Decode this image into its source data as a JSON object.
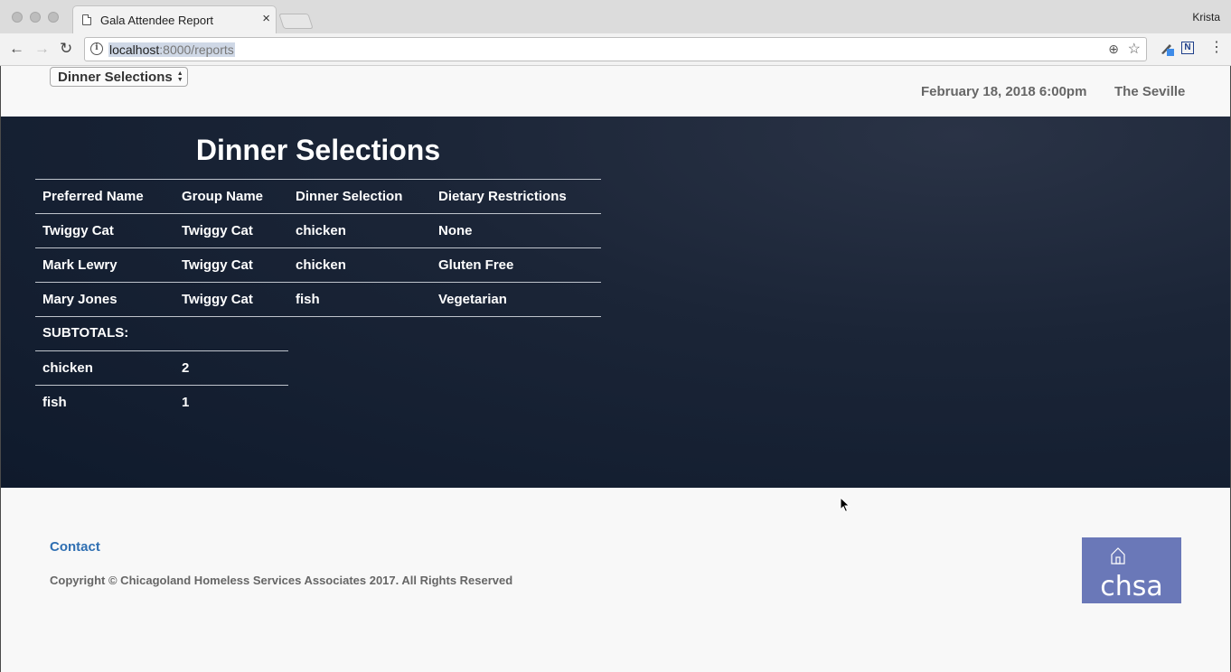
{
  "browser": {
    "tab_title": "Gala Attendee Report",
    "tab_close": "×",
    "profile_name": "Krista",
    "url_host": "localhost",
    "url_rest": ":8000/reports",
    "back": "←",
    "forward": "→",
    "reload": "↻",
    "info": "i",
    "zoom": "⊕",
    "star": "☆",
    "ext2_label": "N",
    "menu": "⋮"
  },
  "header": {
    "report_select_value": "Dinner Selections",
    "event_date": "February 18, 2018 6:00pm",
    "event_venue": "The Seville"
  },
  "report": {
    "title": "Dinner Selections",
    "columns": [
      "Preferred Name",
      "Group Name",
      "Dinner Selection",
      "Dietary Restrictions"
    ],
    "rows": [
      [
        "Twiggy Cat",
        "Twiggy Cat",
        "chicken",
        "None"
      ],
      [
        "Mark Lewry",
        "Twiggy Cat",
        "chicken",
        "Gluten Free"
      ],
      [
        "Mary Jones",
        "Twiggy Cat",
        "fish",
        "Vegetarian"
      ]
    ],
    "subtotals_label": "SUBTOTALS:",
    "subtotals": [
      [
        "chicken",
        "2"
      ],
      [
        "fish",
        "1"
      ]
    ]
  },
  "footer": {
    "contact": "Contact",
    "copyright": "Copyright © Chicagoland Homeless Services Associates 2017. All Rights Reserved",
    "logo_text": "chsa"
  }
}
